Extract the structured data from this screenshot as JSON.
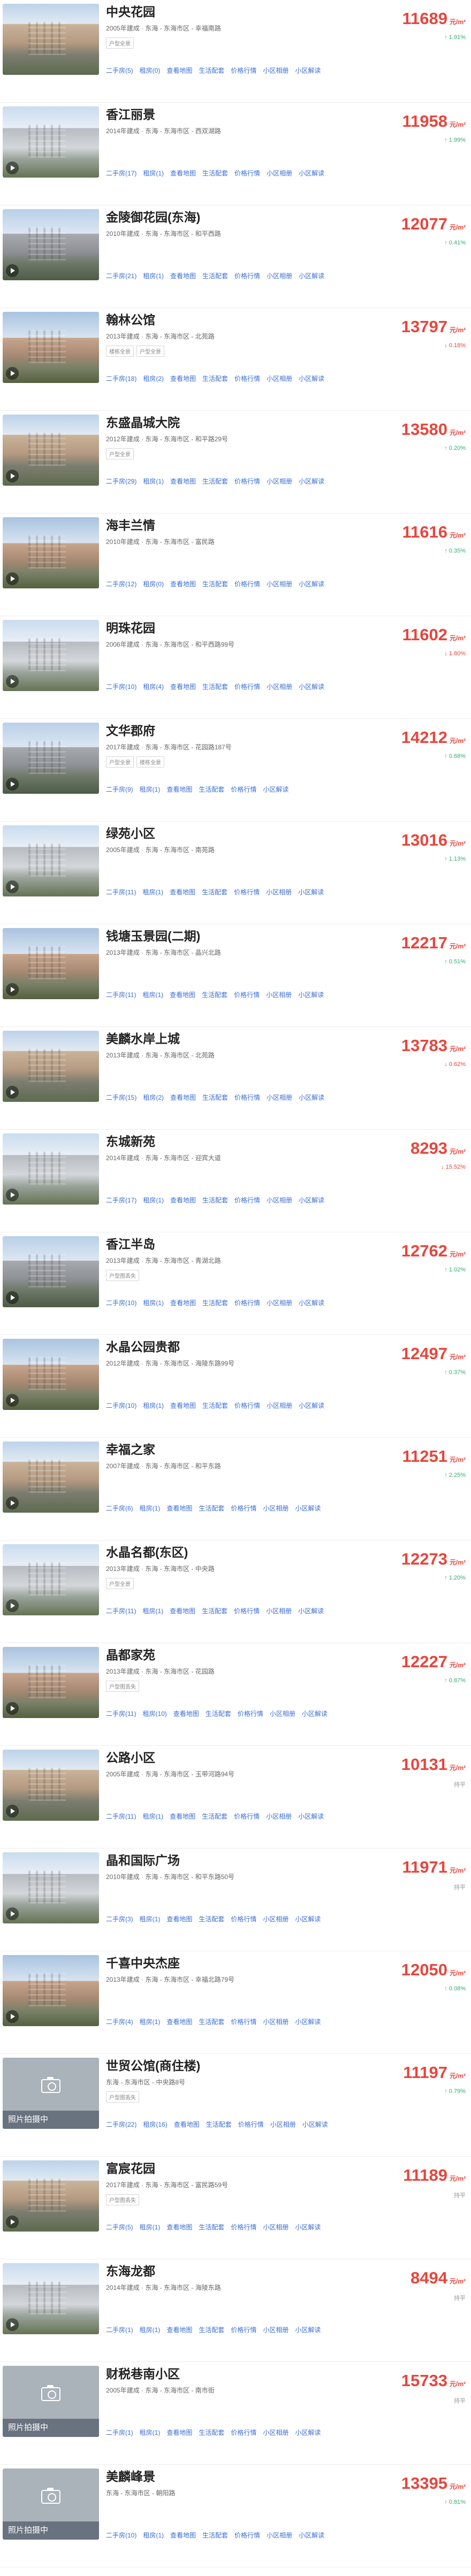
{
  "labels": {
    "unit": "元/m²",
    "play": "play-icon"
  },
  "items": [
    {
      "name": "中央花园",
      "meta": "2005年建成 · 东海 - 东海市区 - 幸福南路",
      "tags": [
        "户型全景"
      ],
      "price": "11689",
      "chg": "↑ 1.91%",
      "dir": "down",
      "links": [
        "二手房(5)",
        "租房(0)",
        "查看地图",
        "生活配套",
        "价格行情",
        "小区相册",
        "小区解读"
      ],
      "thumb": "v1",
      "video": false
    },
    {
      "name": "香江丽景",
      "meta": "2014年建成 · 东海 - 东海市区 - 西双湖路",
      "tags": [],
      "price": "11958",
      "chg": "↑ 1.99%",
      "dir": "down",
      "links": [
        "二手房(17)",
        "租房(1)",
        "查看地图",
        "生活配套",
        "价格行情",
        "小区相册",
        "小区解读"
      ],
      "thumb": "v2",
      "video": true
    },
    {
      "name": "金陵御花园(东海)",
      "meta": "2010年建成 · 东海 - 东海市区 - 和平西路",
      "tags": [],
      "price": "12077",
      "chg": "↑ 0.41%",
      "dir": "down",
      "links": [
        "二手房(21)",
        "租房(1)",
        "查看地图",
        "生活配套",
        "价格行情",
        "小区相册",
        "小区解读"
      ],
      "thumb": "",
      "video": true
    },
    {
      "name": "翰林公馆",
      "meta": "2013年建成 · 东海 - 东海市区 - 北苑路",
      "tags": [
        "楼栋全景",
        "户型全景"
      ],
      "price": "13797",
      "chg": "↓ 0.18%",
      "dir": "up",
      "links": [
        "二手房(18)",
        "租房(2)",
        "查看地图",
        "生活配套",
        "价格行情",
        "小区相册",
        "小区解读"
      ],
      "thumb": "v3",
      "video": true
    },
    {
      "name": "东盛晶城大院",
      "meta": "2012年建成 · 东海 - 东海市区 - 和平路29号",
      "tags": [
        "户型全景"
      ],
      "price": "13580",
      "chg": "↑ 0.20%",
      "dir": "down",
      "links": [
        "二手房(29)",
        "租房(1)",
        "查看地图",
        "生活配套",
        "价格行情",
        "小区相册",
        "小区解读"
      ],
      "thumb": "v1",
      "video": true
    },
    {
      "name": "海丰兰情",
      "meta": "2010年建成 · 东海 - 东海市区 - 富民路",
      "tags": [],
      "price": "11616",
      "chg": "↑ 0.35%",
      "dir": "down",
      "links": [
        "二手房(12)",
        "租房(0)",
        "查看地图",
        "生活配套",
        "价格行情",
        "小区相册",
        "小区解读"
      ],
      "thumb": "v3",
      "video": true
    },
    {
      "name": "明珠花园",
      "meta": "2006年建成 · 东海 - 东海市区 - 和平西路99号",
      "tags": [],
      "price": "11602",
      "chg": "↓ 1.80%",
      "dir": "up",
      "links": [
        "二手房(10)",
        "租房(4)",
        "查看地图",
        "生活配套",
        "价格行情",
        "小区相册",
        "小区解读"
      ],
      "thumb": "v2",
      "video": true
    },
    {
      "name": "文华郡府",
      "meta": "2017年建成 · 东海 - 东海市区 - 花园路187号",
      "tags": [
        "户型全景",
        "楼栋全景"
      ],
      "price": "14212",
      "chg": "↑ 0.68%",
      "dir": "down",
      "links": [
        "二手房(9)",
        "租房(1)",
        "查看地图",
        "生活配套",
        "价格行情",
        "小区解读"
      ],
      "thumb": "",
      "video": true
    },
    {
      "name": "绿苑小区",
      "meta": "2005年建成 · 东海 - 东海市区 - 南苑路",
      "tags": [],
      "price": "13016",
      "chg": "↑ 1.13%",
      "dir": "down",
      "links": [
        "二手房(11)",
        "租房(1)",
        "查看地图",
        "生活配套",
        "价格行情",
        "小区相册",
        "小区解读"
      ],
      "thumb": "v2",
      "video": true
    },
    {
      "name": "钱塘玉景园(二期)",
      "meta": "2013年建成 · 东海 - 东海市区 - 晶兴北路",
      "tags": [],
      "price": "12217",
      "chg": "↑ 0.51%",
      "dir": "down",
      "links": [
        "二手房(11)",
        "租房(1)",
        "查看地图",
        "生活配套",
        "价格行情",
        "小区相册",
        "小区解读"
      ],
      "thumb": "v3",
      "video": true
    },
    {
      "name": "美麟水岸上城",
      "meta": "2013年建成 · 东海 - 东海市区 - 北苑路",
      "tags": [],
      "price": "13783",
      "chg": "↓ 0.62%",
      "dir": "up",
      "links": [
        "二手房(15)",
        "租房(2)",
        "查看地图",
        "生活配套",
        "价格行情",
        "小区相册",
        "小区解读"
      ],
      "thumb": "v1",
      "video": true
    },
    {
      "name": "东城新苑",
      "meta": "2014年建成 · 东海 - 东海市区 - 迎宾大道",
      "tags": [],
      "price": "8293",
      "chg": "↓ 15.52%",
      "dir": "up",
      "links": [
        "二手房(17)",
        "租房(1)",
        "查看地图",
        "生活配套",
        "价格行情",
        "小区相册",
        "小区解读"
      ],
      "thumb": "v2",
      "video": true
    },
    {
      "name": "香江半岛",
      "meta": "2013年建成 · 东海 - 东海市区 - 青湖北路",
      "tags": [
        "户型图丢失"
      ],
      "price": "12762",
      "chg": "↑ 1.02%",
      "dir": "down",
      "links": [
        "二手房(10)",
        "租房(1)",
        "查看地图",
        "生活配套",
        "价格行情",
        "小区相册",
        "小区解读"
      ],
      "thumb": "",
      "video": true
    },
    {
      "name": "水晶公园贵都",
      "meta": "2012年建成 · 东海 - 东海市区 - 海陵东路99号",
      "tags": [],
      "price": "12497",
      "chg": "↑ 0.37%",
      "dir": "down",
      "links": [
        "二手房(10)",
        "租房(1)",
        "查看地图",
        "生活配套",
        "价格行情",
        "小区相册",
        "小区解读"
      ],
      "thumb": "v3",
      "video": true
    },
    {
      "name": "幸福之家",
      "meta": "2007年建成 · 东海 - 东海市区 - 和平东路",
      "tags": [],
      "price": "11251",
      "chg": "↑ 2.25%",
      "dir": "down",
      "links": [
        "二手房(6)",
        "租房(1)",
        "查看地图",
        "生活配套",
        "价格行情",
        "小区相册",
        "小区解读"
      ],
      "thumb": "v1",
      "video": true
    },
    {
      "name": "水晶名都(东区)",
      "meta": "2013年建成 · 东海 - 东海市区 - 中央路",
      "tags": [
        "户型全景"
      ],
      "price": "12273",
      "chg": "↑ 1.20%",
      "dir": "down",
      "links": [
        "二手房(11)",
        "租房(1)",
        "查看地图",
        "生活配套",
        "价格行情",
        "小区相册",
        "小区解读"
      ],
      "thumb": "v2",
      "video": true
    },
    {
      "name": "晶都家苑",
      "meta": "2013年建成 · 东海 - 东海市区 - 花园路",
      "tags": [
        "户型图丢失"
      ],
      "price": "12227",
      "chg": "↑ 0.87%",
      "dir": "down",
      "links": [
        "二手房(11)",
        "租房(10)",
        "查看地图",
        "生活配套",
        "价格行情",
        "小区相册",
        "小区解读"
      ],
      "thumb": "v3",
      "video": true
    },
    {
      "name": "公路小区",
      "meta": "2005年建成 · 东海 - 东海市区 - 玉带河路94号",
      "tags": [],
      "price": "10131",
      "chg": "持平",
      "dir": "flat",
      "links": [
        "二手房(11)",
        "租房(1)",
        "查看地图",
        "生活配套",
        "价格行情",
        "小区相册",
        "小区解读"
      ],
      "thumb": "v1",
      "video": true
    },
    {
      "name": "晶和国际广场",
      "meta": "2010年建成 · 东海 - 东海市区 - 和平东路50号",
      "tags": [],
      "price": "11971",
      "chg": "持平",
      "dir": "flat",
      "links": [
        "二手房(3)",
        "租房(1)",
        "查看地图",
        "生活配套",
        "价格行情",
        "小区相册",
        "小区解读"
      ],
      "thumb": "v2",
      "video": true
    },
    {
      "name": "千喜中央杰座",
      "meta": "2013年建成 · 东海 - 东海市区 - 幸福北路79号",
      "tags": [],
      "price": "12050",
      "chg": "↑ 0.08%",
      "dir": "down",
      "links": [
        "二手房(4)",
        "租房(1)",
        "查看地图",
        "生活配套",
        "价格行情",
        "小区相册",
        "小区解读"
      ],
      "thumb": "v3",
      "video": true
    },
    {
      "name": "世贸公馆(商住楼)",
      "meta": "东海 - 东海市区 - 中央路8号",
      "tags": [
        "户型图丢失"
      ],
      "price": "11197",
      "chg": "↑ 0.79%",
      "dir": "down",
      "links": [
        "二手房(22)",
        "租房(16)",
        "查看地图",
        "生活配套",
        "价格行情",
        "小区相册",
        "小区解读"
      ],
      "thumb": "ph",
      "video": false,
      "placeholder": "照片拍摄中"
    },
    {
      "name": "富宸花园",
      "meta": "2017年建成 · 东海 - 东海市区 - 富民路59号",
      "tags": [
        "户型图丢失"
      ],
      "price": "11189",
      "chg": "持平",
      "dir": "flat",
      "links": [
        "二手房(5)",
        "租房(1)",
        "查看地图",
        "生活配套",
        "价格行情",
        "小区相册",
        "小区解读"
      ],
      "thumb": "v1",
      "video": true
    },
    {
      "name": "东海龙都",
      "meta": "2014年建成 · 东海 - 东海市区 - 海陵东路",
      "tags": [],
      "price": "8494",
      "chg": "持平",
      "dir": "flat",
      "links": [
        "二手房(1)",
        "租房(1)",
        "查看地图",
        "生活配套",
        "价格行情",
        "小区相册",
        "小区解读"
      ],
      "thumb": "v2",
      "video": true
    },
    {
      "name": "财税巷南小区",
      "meta": "2005年建成 · 东海 - 东海市区 - 南市街",
      "tags": [],
      "price": "15733",
      "chg": "持平",
      "dir": "flat",
      "links": [
        "二手房(1)",
        "租房(1)",
        "查看地图",
        "生活配套",
        "价格行情",
        "小区相册",
        "小区解读"
      ],
      "thumb": "ph",
      "video": false,
      "placeholder": "照片拍摄中"
    },
    {
      "name": "美麟峰景",
      "meta": "东海 - 东海市区 - 朝阳路",
      "tags": [],
      "price": "13395",
      "chg": "↑ 0.81%",
      "dir": "down",
      "links": [
        "二手房(10)",
        "租房(1)",
        "查看地图",
        "生活配套",
        "价格行情",
        "小区相册",
        "小区解读"
      ],
      "thumb": "ph",
      "video": false,
      "placeholder": "照片拍摄中"
    }
  ]
}
